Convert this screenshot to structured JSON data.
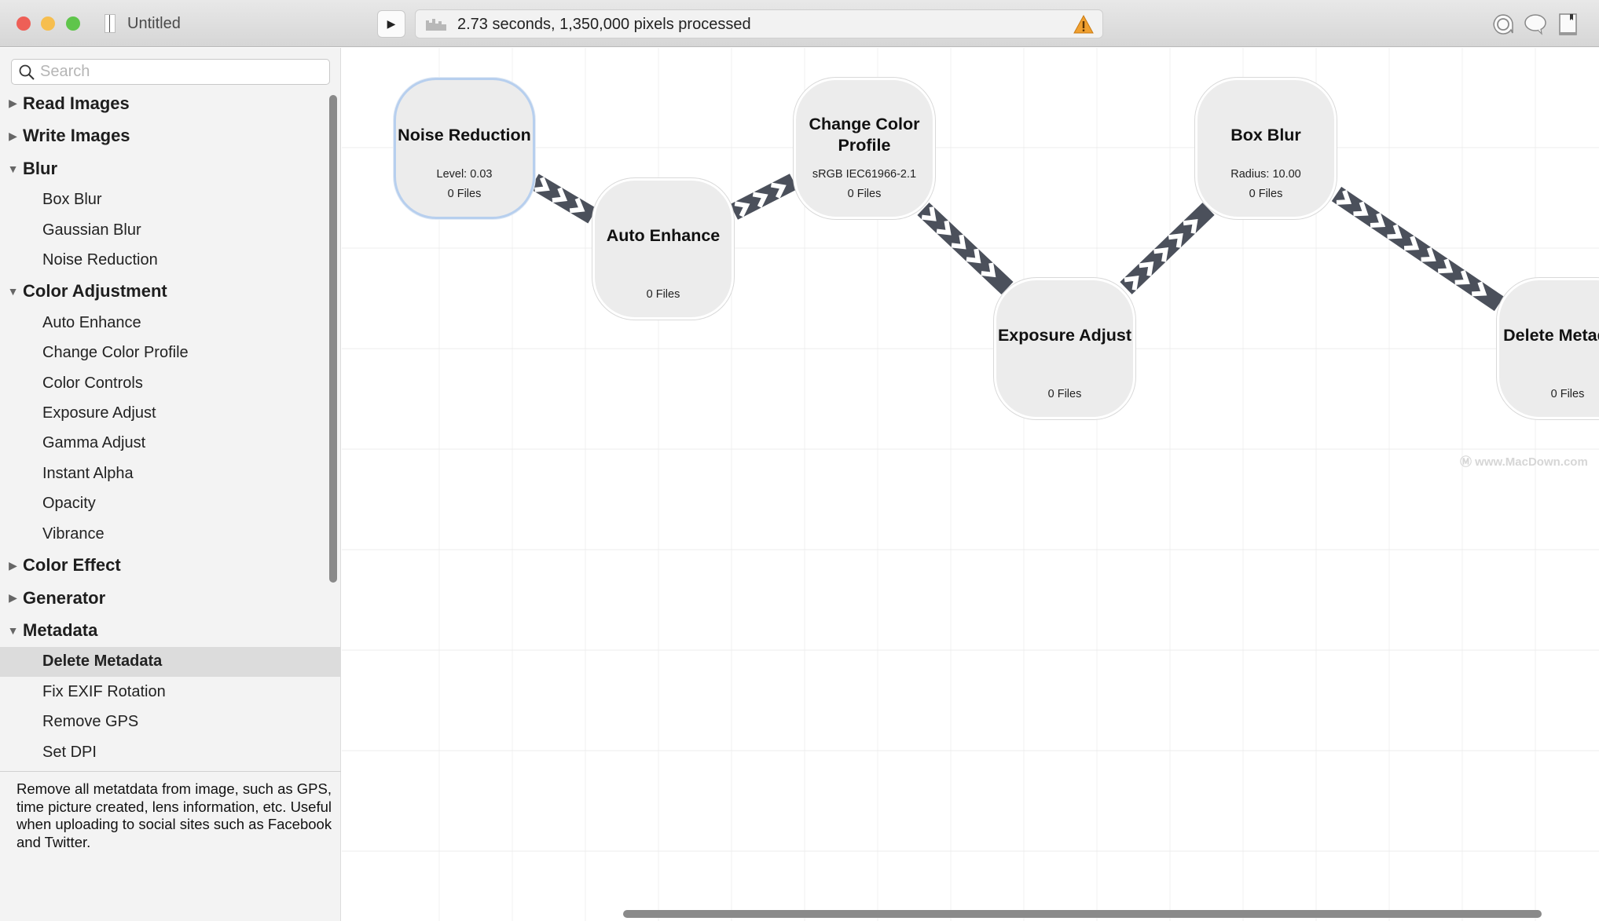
{
  "window": {
    "title": "Untitled",
    "traffic_lights": {
      "close": "#ee5f57",
      "minimize": "#f6be4f",
      "zoom": "#5fc54b"
    },
    "toolbar": {
      "play_icon": "play-icon",
      "status_text": "2.73 seconds, 1,350,000 pixels processed",
      "status_icon": "progress-icon",
      "warning_icon": "warning-icon",
      "right_icons": [
        "inspector-icon",
        "comment-icon",
        "book-icon"
      ]
    }
  },
  "sidebar": {
    "search_placeholder": "Search",
    "tree": [
      {
        "label": "Read Images",
        "expanded": false,
        "items": []
      },
      {
        "label": "Write Images",
        "expanded": false,
        "items": []
      },
      {
        "label": "Blur",
        "expanded": true,
        "items": [
          "Box Blur",
          "Gaussian Blur",
          "Noise Reduction"
        ]
      },
      {
        "label": "Color Adjustment",
        "expanded": true,
        "items": [
          "Auto Enhance",
          "Change Color Profile",
          "Color Controls",
          "Exposure Adjust",
          "Gamma Adjust",
          "Instant Alpha",
          "Opacity",
          "Vibrance"
        ]
      },
      {
        "label": "Color Effect",
        "expanded": false,
        "items": []
      },
      {
        "label": "Generator",
        "expanded": false,
        "items": []
      },
      {
        "label": "Metadata",
        "expanded": true,
        "items": [
          "Delete Metadata",
          "Fix EXIF Rotation",
          "Remove GPS",
          "Set DPI"
        ]
      }
    ],
    "selected_item": "Delete Metadata",
    "description": "Remove all metatdata from image, such as GPS, time picture created, lens information, etc. Useful when uploading to social sites such as Facebook and Twitter."
  },
  "canvas": {
    "nodes": [
      {
        "title": "Noise Reduction",
        "param": "Level: 0.03",
        "files": "0 Files",
        "selected": true
      },
      {
        "title": "Auto Enhance",
        "param": "",
        "files": "0 Files",
        "selected": false
      },
      {
        "title": "Change Color Profile",
        "param": "sRGB IEC61966-2.1",
        "files": "0 Files",
        "selected": false
      },
      {
        "title": "Exposure Adjust",
        "param": "",
        "files": "0 Files",
        "selected": false
      },
      {
        "title": "Box Blur",
        "param": "Radius: 10.00",
        "files": "0 Files",
        "selected": false
      },
      {
        "title": "Delete Metadata",
        "param": "",
        "files": "0 Files",
        "selected": false
      }
    ],
    "connections": [
      [
        0,
        1
      ],
      [
        1,
        2
      ],
      [
        2,
        3
      ],
      [
        3,
        4
      ],
      [
        4,
        5
      ]
    ],
    "connector_color": "#4b505b",
    "watermark": "www.MacDown.com"
  }
}
